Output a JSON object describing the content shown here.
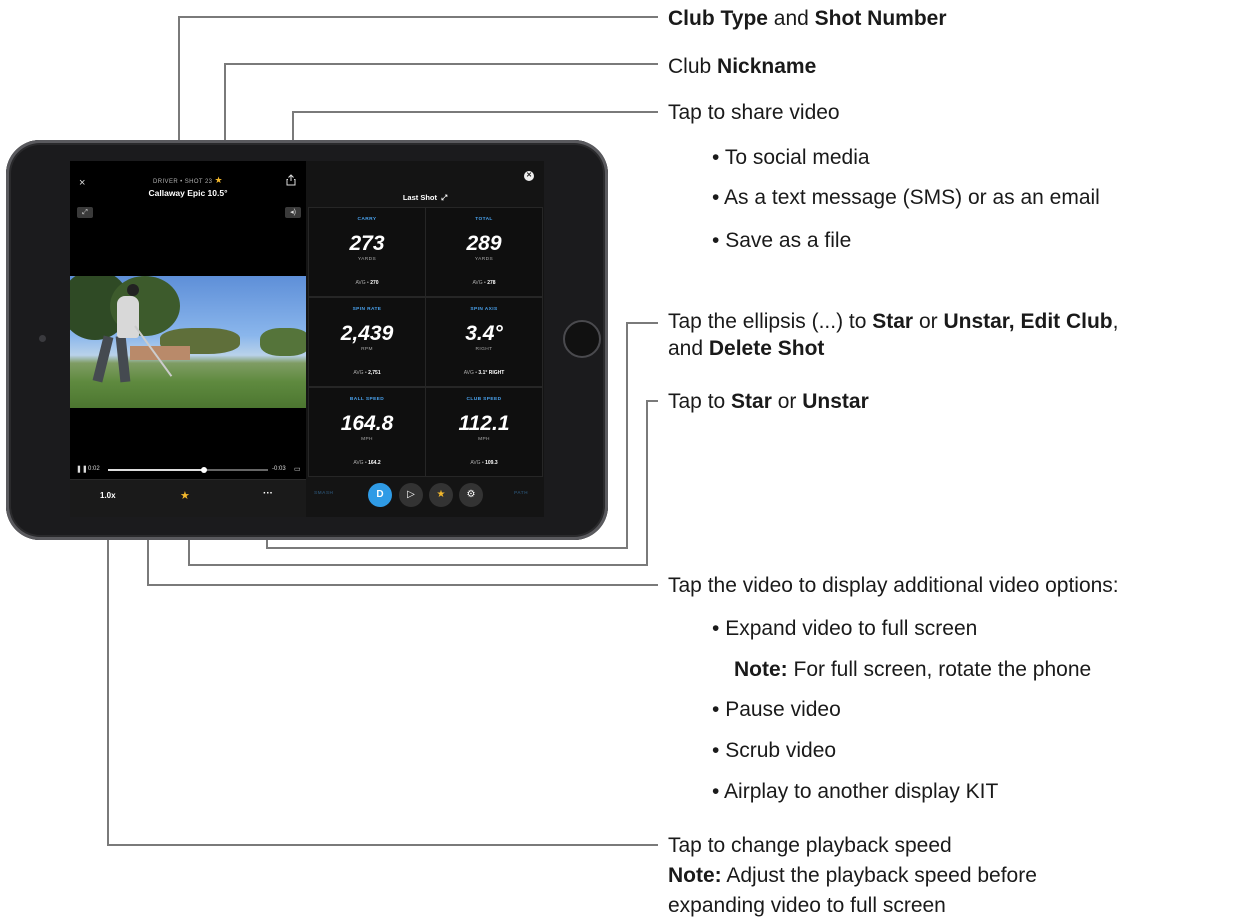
{
  "app": {
    "shot_line": "DRIVER • SHOT 23",
    "club_name": "Callaway Epic 10.5°",
    "close_glyph": "×",
    "time_elapsed": "0:02",
    "time_remaining": "-0:03",
    "playback_progress": 0.6,
    "speed_label": "1.0x",
    "more_glyph": "···",
    "last_shot_label": "Last Shot",
    "metrics": [
      {
        "label": "CARRY",
        "value": "273",
        "unit": "YARDS",
        "avg": "270"
      },
      {
        "label": "TOTAL",
        "value": "289",
        "unit": "YARDS",
        "avg": "278"
      },
      {
        "label": "SPIN RATE",
        "value": "2,439",
        "unit": "RPM",
        "avg": "2,751"
      },
      {
        "label": "SPIN AXIS",
        "value": "3.4°",
        "unit": "RIGHT",
        "avg": "3.1° RIGHT"
      },
      {
        "label": "BALL SPEED",
        "value": "164.8",
        "unit": "MPH",
        "avg": "164.2"
      },
      {
        "label": "CLUB SPEED",
        "value": "112.1",
        "unit": "MPH",
        "avg": "109.3"
      }
    ],
    "avg_prefix": "AVG • ",
    "nav_left_faint": "SMASH",
    "nav_right_faint": "PATH",
    "nav_club_letter": "D",
    "accent_color": "#2f9be6",
    "star_color": "#f3b82c"
  },
  "callouts": {
    "club_type": {
      "b1": "Club Type",
      "mid": " and ",
      "b2": "Shot Number"
    },
    "nickname": {
      "pre": "Club ",
      "b": "Nickname"
    },
    "share": {
      "title": "Tap to share video",
      "items": [
        "To social media",
        "As a text message (SMS) or as an email",
        "Save as a file"
      ]
    },
    "ellipsis": {
      "pre": "Tap the ellipsis (...) to ",
      "b1": "Star",
      "mid": " or ",
      "b2": "Unstar, Edit Club",
      "post": ",",
      "line2_pre": "and ",
      "line2_b": "Delete Shot"
    },
    "star": {
      "pre": "Tap to ",
      "b1": "Star",
      "mid": " or ",
      "b2": "Unstar"
    },
    "video": {
      "title": "Tap the video to display additional video options:",
      "item1": "Expand video to full screen",
      "note_b": "Note:",
      "note_text": " For full screen, rotate the phone",
      "items": [
        "Pause video",
        "Scrub video",
        "Airplay to another display KIT"
      ]
    },
    "speed": {
      "title": "Tap to change playback speed",
      "note_b": "Note:",
      "note_text": " Adjust the playback speed before",
      "line3": "expanding video to full screen"
    }
  }
}
